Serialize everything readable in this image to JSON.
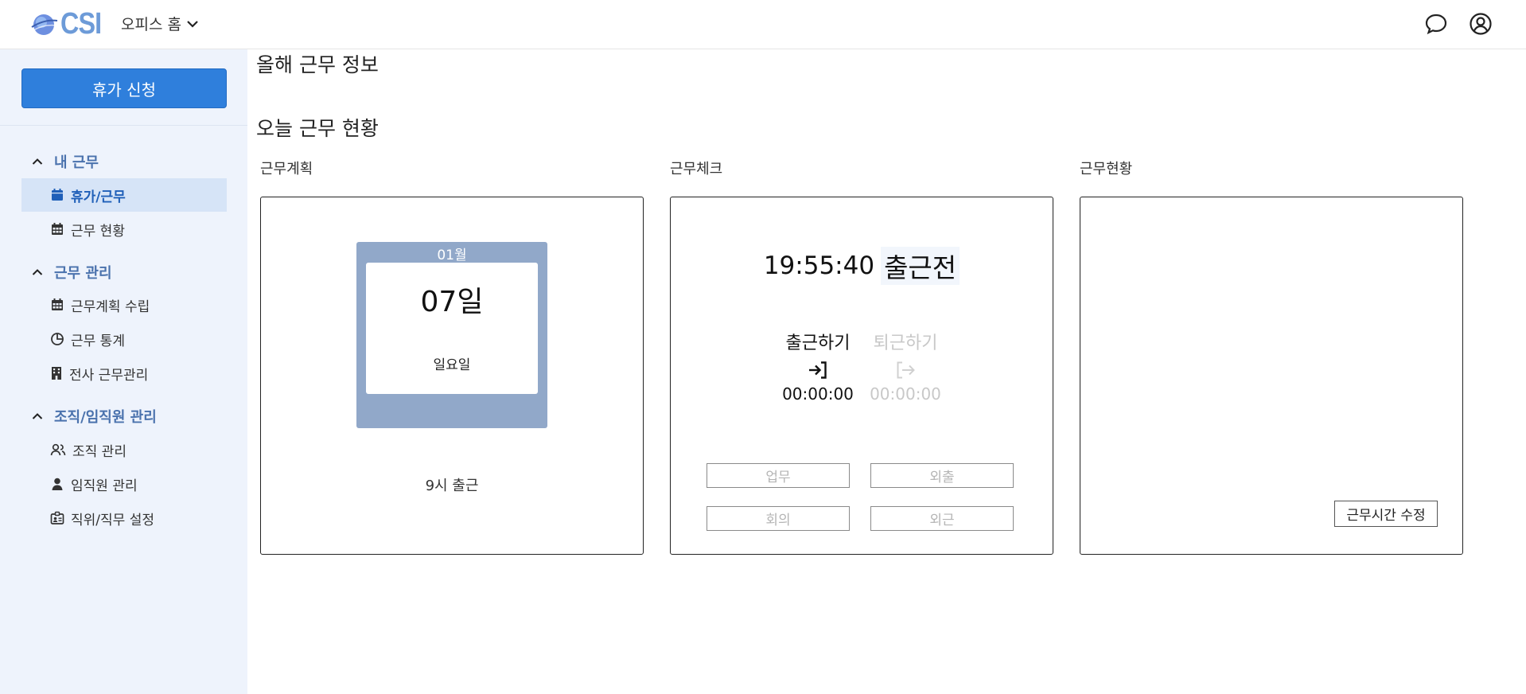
{
  "header": {
    "logo_text": "CSI",
    "office_menu_label": "오피스 홈",
    "icons": [
      "chat-icon",
      "account-icon"
    ]
  },
  "sidebar": {
    "leave_button": "휴가 신청",
    "groups": [
      {
        "label": "내 근무",
        "items": [
          {
            "label": "휴가/근무",
            "icon": "calendar-icon",
            "active": true
          },
          {
            "label": "근무 현황",
            "icon": "calendar-grid-icon"
          }
        ]
      },
      {
        "label": "근무 관리",
        "items": [
          {
            "label": "근무계획 수립",
            "icon": "calendar-grid-icon"
          },
          {
            "label": "근무 통계",
            "icon": "pie-chart-icon"
          },
          {
            "label": "전사 근무관리",
            "icon": "building-icon"
          }
        ]
      },
      {
        "label": "조직/임직원 관리",
        "items": [
          {
            "label": "조직 관리",
            "icon": "people-icon"
          },
          {
            "label": "임직원 관리",
            "icon": "person-icon"
          },
          {
            "label": "직위/직무 설정",
            "icon": "badge-icon"
          }
        ]
      }
    ],
    "colors": {
      "background": "#eef3fc",
      "active_bg": "#d6e4f7",
      "group_text": "#4a72ad",
      "button": "#2f7fdc"
    }
  },
  "main": {
    "year_title": "올해 근무 정보",
    "today_title": "오늘 근무 현황",
    "plan": {
      "label": "근무계획",
      "month": "01월",
      "day": "07일",
      "weekday": "일요일",
      "note": "9시 출근"
    },
    "check": {
      "label": "근무체크",
      "clock": "19:55:40",
      "status": "출근전",
      "clock_in": {
        "label": "출근하기",
        "time": "00:00:00",
        "icon": "sign-in-icon",
        "enabled": true
      },
      "clock_out": {
        "label": "퇴근하기",
        "time": "00:00:00",
        "icon": "sign-out-icon",
        "enabled": false
      },
      "actions": [
        "업무",
        "외출",
        "회의",
        "외근"
      ]
    },
    "status": {
      "label": "근무현황",
      "edit_button": "근무시간 수정"
    }
  }
}
